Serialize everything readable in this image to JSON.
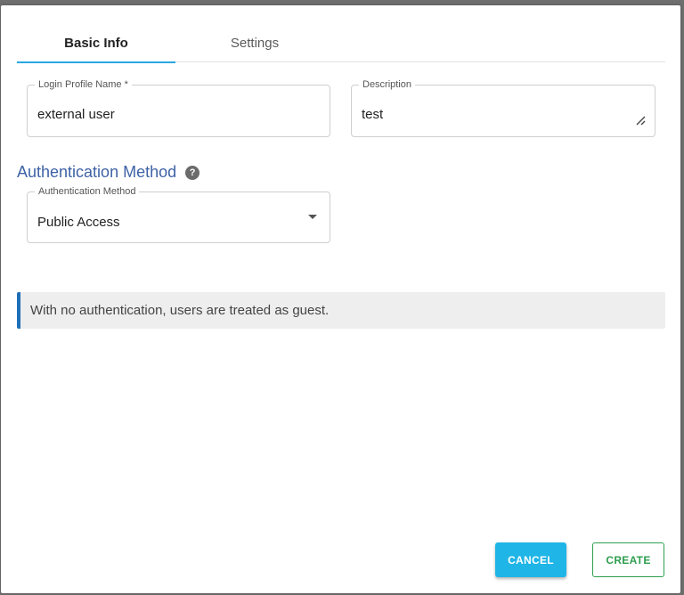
{
  "tabs": [
    {
      "label": "Basic Info",
      "active": true
    },
    {
      "label": "Settings",
      "active": false
    }
  ],
  "fields": {
    "login_profile_name": {
      "label": "Login Profile Name *",
      "value": "external user"
    },
    "description": {
      "label": "Description",
      "value": "test"
    },
    "auth_method": {
      "label": "Authentication Method",
      "value": "Public Access"
    }
  },
  "section": {
    "title": "Authentication Method",
    "help_glyph": "?"
  },
  "info": {
    "text": "With no authentication, users are treated as guest."
  },
  "buttons": {
    "cancel": "CANCEL",
    "create": "CREATE"
  },
  "colors": {
    "accent": "#29a7e1",
    "section_title": "#3f62a6",
    "info_border": "#1f6fb8",
    "cancel_bg": "#1fb5e6",
    "create_border": "#2e9e4e"
  }
}
